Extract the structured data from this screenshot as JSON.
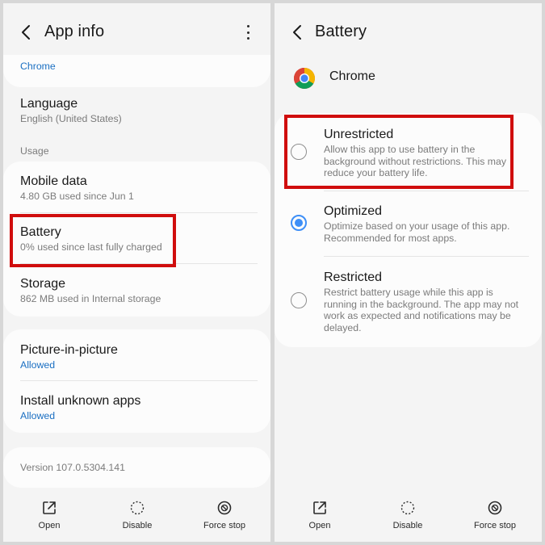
{
  "left_panel": {
    "header": {
      "title": "App info",
      "back_icon": "chevron-left-icon",
      "menu_icon": "more-vertical-icon"
    },
    "top_item": {
      "subtitle": "Chrome"
    },
    "language": {
      "title": "Language",
      "subtitle": "English (United States)"
    },
    "usage_label": "Usage",
    "mobile_data": {
      "title": "Mobile data",
      "subtitle": "4.80 GB used since Jun 1"
    },
    "battery": {
      "title": "Battery",
      "subtitle": "0% used since last fully charged"
    },
    "storage": {
      "title": "Storage",
      "subtitle": "862 MB used in Internal storage"
    },
    "pip": {
      "title": "Picture-in-picture",
      "subtitle": "Allowed"
    },
    "unknown_apps": {
      "title": "Install unknown apps",
      "subtitle": "Allowed"
    },
    "version": "Version 107.0.5304.141",
    "bottom": {
      "open": "Open",
      "disable": "Disable",
      "force_stop": "Force stop"
    }
  },
  "right_panel": {
    "header": {
      "title": "Battery",
      "back_icon": "chevron-left-icon"
    },
    "app_name": "Chrome",
    "app_icon": "chrome-icon",
    "options": [
      {
        "title": "Unrestricted",
        "desc": "Allow this app to use battery in the background without restrictions. This may reduce your battery life.",
        "selected": false
      },
      {
        "title": "Optimized",
        "desc": "Optimize based on your usage of this app. Recommended for most apps.",
        "selected": true
      },
      {
        "title": "Restricted",
        "desc": "Restrict battery usage while this app is running in the background. The app may not work as expected and notifications may be delayed.",
        "selected": false
      }
    ],
    "bottom": {
      "open": "Open",
      "disable": "Disable",
      "force_stop": "Force stop"
    }
  },
  "colors": {
    "highlight": "#d00d0d",
    "accent": "#3e8ff7",
    "link": "#1a6fc2"
  }
}
